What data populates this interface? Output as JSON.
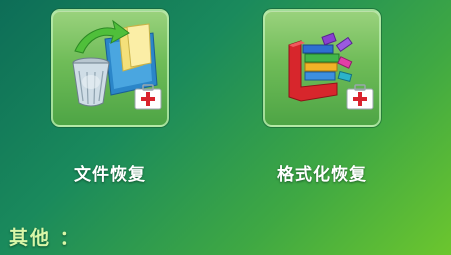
{
  "options": [
    {
      "label": "文件恢复",
      "icon": "recycle-bin-folder-icon"
    },
    {
      "label": "格式化恢复",
      "icon": "color-blocks-icon"
    }
  ],
  "section": {
    "title": "其他 ："
  },
  "badge_icon": "first-aid-kit-icon",
  "colors": {
    "background_start": "#0d6d57",
    "background_end": "#6cc62e",
    "tile": "#6fbc58",
    "section_title": "#d9f7a8"
  }
}
